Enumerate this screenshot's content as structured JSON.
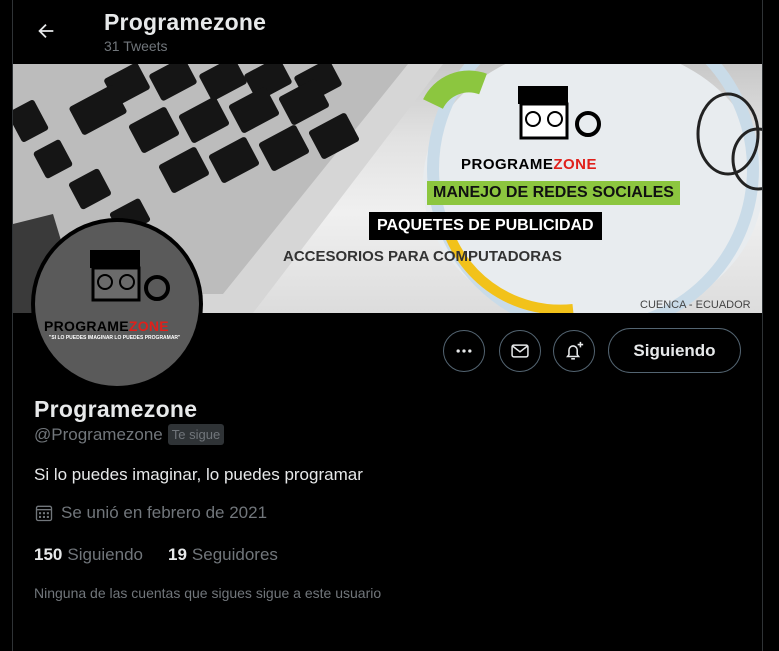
{
  "header": {
    "title": "Programezone",
    "tweet_count": "31 Tweets"
  },
  "banner": {
    "logo_part1": "PROGRAME",
    "logo_part2": "ZONE",
    "line1": "MANEJO DE REDES SOCIALES",
    "line2": "PAQUETES DE PUBLICIDAD",
    "line3": "ACCESORIOS PARA COMPUTADORAS",
    "location": "CUENCA - ECUADOR"
  },
  "avatar": {
    "logo_part1": "PROGRAME",
    "logo_part2": "ZONE",
    "slogan": "\"SI LO PUEDES IMAGINAR LO PUEDES PROGRAMAR\""
  },
  "actions": {
    "follow_label": "Siguiendo",
    "icons": [
      "more-icon",
      "message-icon",
      "notifications-icon"
    ]
  },
  "profile": {
    "name": "Programezone",
    "handle": "@Programezone",
    "follows_you": "Te sigue",
    "bio": "Si lo puedes imaginar, lo puedes programar",
    "joined": "Se unió en febrero de 2021",
    "following_count": "150",
    "following_label": "Siguiendo",
    "followers_count": "19",
    "followers_label": "Seguidores",
    "mutuals_note": "Ninguna de las cuentas que sigues sigue a este usuario"
  },
  "colors": {
    "background": "#000000",
    "text": "#e7e9ea",
    "muted": "#71767b",
    "border": "#536471",
    "banner_green": "#8cc63f",
    "logo_red": "#e0201b"
  }
}
